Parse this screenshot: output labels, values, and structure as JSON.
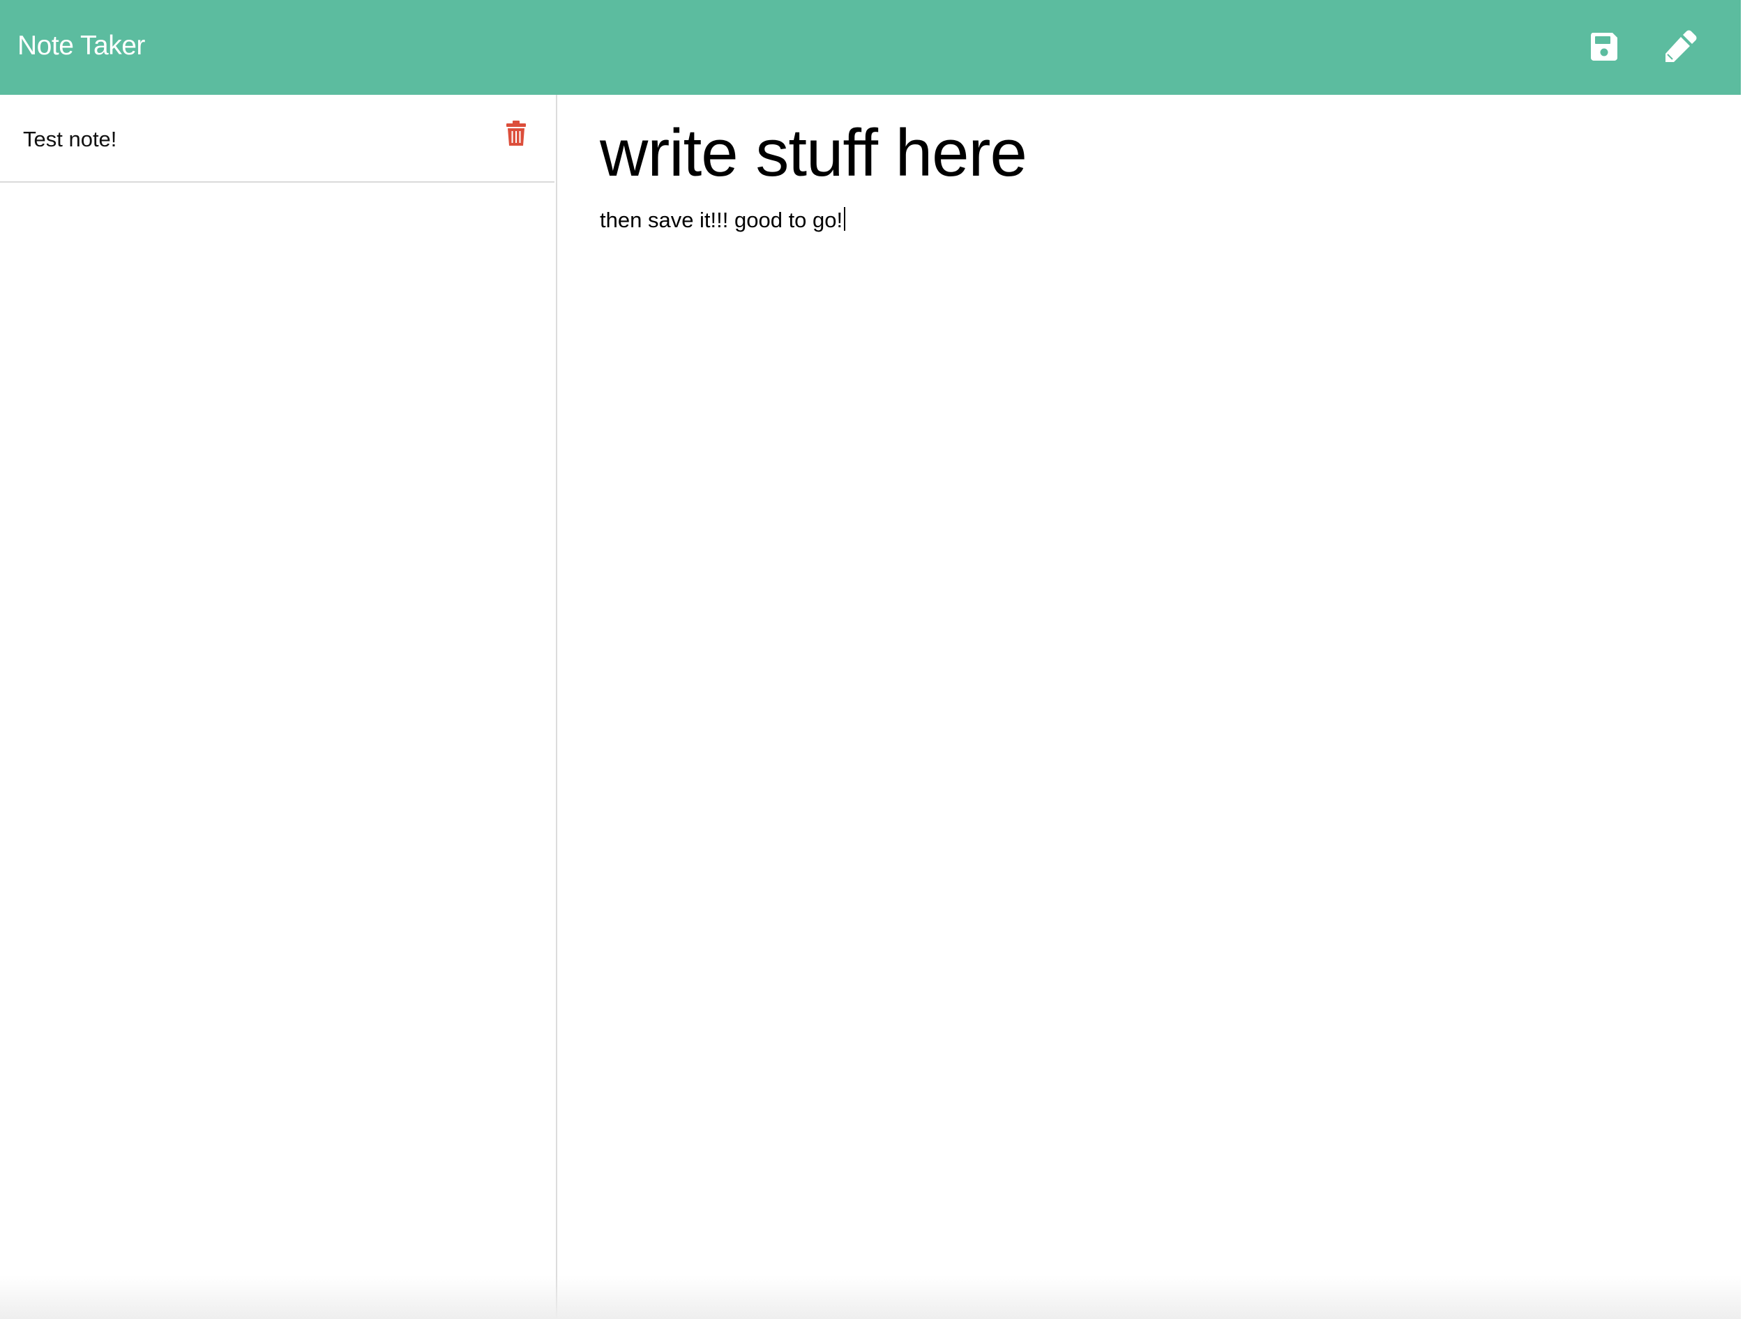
{
  "app": {
    "title": "Note Taker",
    "accent_color": "#5cbc9f",
    "danger_color": "#dc4e3b"
  },
  "toolbar": {
    "save_icon": "save-icon",
    "new_icon": "pencil-icon"
  },
  "sidebar": {
    "notes": [
      {
        "title": "Test note!",
        "delete_icon": "trash-icon"
      }
    ]
  },
  "editor": {
    "title": "write stuff here",
    "body": "then save it!!! good to go!"
  }
}
